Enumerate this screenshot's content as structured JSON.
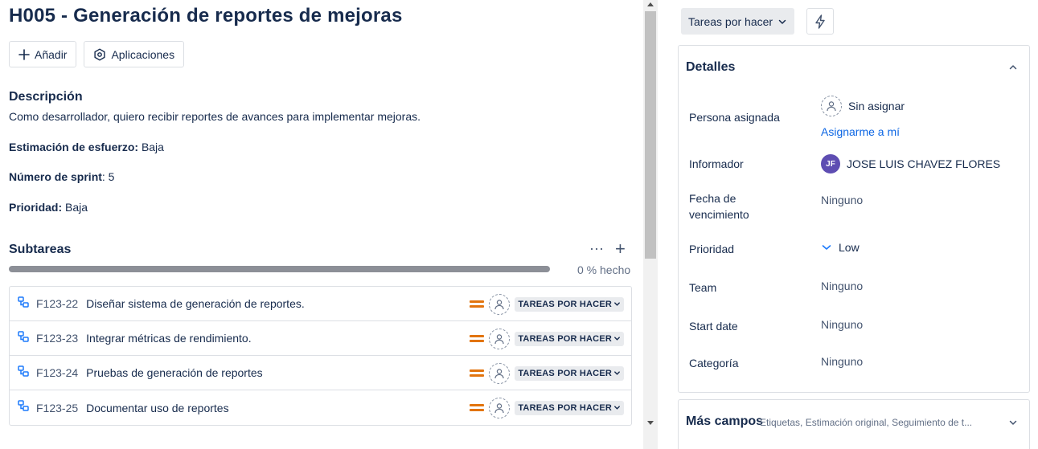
{
  "issue": {
    "title": "H005 - Generación de reportes de mejoras"
  },
  "toolbar": {
    "add_label": "Añadir",
    "apps_label": "Aplicaciones"
  },
  "description": {
    "heading": "Descripción",
    "text": "Como desarrollador, quiero recibir reportes de avances para implementar mejoras.",
    "effort_label": "Estimación de esfuerzo:",
    "effort_value": "Baja",
    "sprint_label": "Número de sprint",
    "sprint_value": ": 5",
    "priority_label": "Prioridad:",
    "priority_value": "Baja"
  },
  "subtasks": {
    "heading": "Subtareas",
    "more_label": "···",
    "add_label": "+",
    "progress_percent": 0,
    "progress_label": "0 % hecho",
    "items": [
      {
        "key": "F123-22",
        "summary": "Diseñar sistema de generación de reportes.",
        "status": "TAREAS POR HACER"
      },
      {
        "key": "F123-23",
        "summary": "Integrar métricas de rendimiento.",
        "status": "TAREAS POR HACER"
      },
      {
        "key": "F123-24",
        "summary": "Pruebas de generación de reportes",
        "status": "TAREAS POR HACER"
      },
      {
        "key": "F123-25",
        "summary": "Documentar uso de reportes",
        "status": "TAREAS POR HACER"
      }
    ]
  },
  "status_button": {
    "label": "Tareas por hacer"
  },
  "details": {
    "heading": "Detalles",
    "assignee_label": "Persona asignada",
    "assignee_value": "Sin asignar",
    "assign_me": "Asignarme a mí",
    "reporter_label": "Informador",
    "reporter_initials": "JF",
    "reporter_value": "JOSE LUIS CHAVEZ FLORES",
    "due_label": "Fecha de vencimiento",
    "due_value": "Ninguno",
    "priority_label": "Prioridad",
    "priority_value": "Low",
    "team_label": "Team",
    "team_value": "Ninguno",
    "start_label": "Start date",
    "start_value": "Ninguno",
    "category_label": "Categoría",
    "category_value": "Ninguno"
  },
  "more_fields": {
    "heading": "Más campos",
    "summary": "Etiquetas, Estimación original, Seguimiento de t..."
  },
  "colors": {
    "priority_medium": "#e2740e",
    "link": "#0c66e4",
    "subtask_icon": "#1d7afc",
    "reporter_avatar": "#5e4db2"
  },
  "icons": {
    "add": "plus-icon",
    "apps": "apps-icon",
    "subtask": "subtask-icon",
    "priority": "priority-medium-icon",
    "assignee": "unassigned-avatar-icon",
    "status_dropdown": "chevron-down-icon",
    "automation": "bolt-icon",
    "collapse": "chevron-up-icon",
    "priority_low": "chevron-down-blue-icon"
  }
}
